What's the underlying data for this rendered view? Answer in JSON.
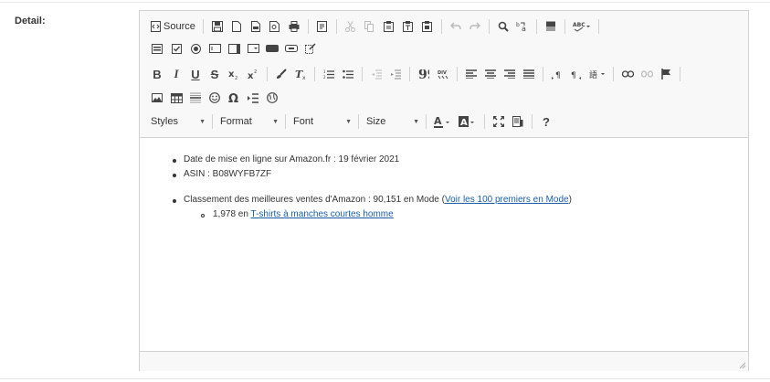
{
  "form": {
    "field_label": "Detail:"
  },
  "toolbar": {
    "source_label": "Source",
    "styles_label": "Styles",
    "format_label": "Format",
    "font_label": "Font",
    "size_label": "Size",
    "bold": "B",
    "italic": "I",
    "underline": "U",
    "strike": "S",
    "help": "?"
  },
  "content": {
    "item1_text": "Date de mise en ligne sur Amazon.fr  :  19 février 2021",
    "item2_text": "ASIN  :  B08WYFB7ZF",
    "item3_text": "Classement des meilleures ventes d'Amazon : 90,151 en Mode (",
    "item3_link": "Voir les 100 premiers en Mode",
    "item3_close": ")",
    "sub_item_text": "1,978 en ",
    "sub_item_link": "T-shirts à manches courtes homme"
  }
}
